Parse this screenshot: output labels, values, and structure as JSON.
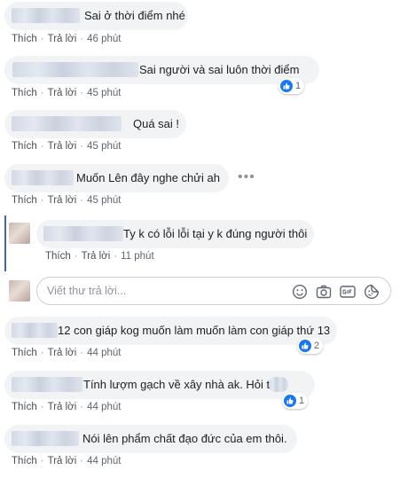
{
  "actions": {
    "like": "Thích",
    "reply": "Trả lời",
    "separator": "·"
  },
  "comments": [
    {
      "text": "Sai ở thời điểm nhé",
      "time": "46 phút"
    },
    {
      "text": "Sai người và sai luôn thời điểm",
      "time": "45 phút",
      "reactions": "1"
    },
    {
      "text": "Quá sai !",
      "time": "45 phút"
    },
    {
      "text": "Muốn Lên đây nghe chửi ah",
      "time": "45 phút"
    },
    {
      "text": "Ty k có lỗi lỗi tại y k đúng người thôi",
      "time": "11 phút"
    },
    {
      "text": "12 con giáp kog muốn làm muốn làm con giáp thứ 13",
      "time": "44 phút",
      "reactions": "2"
    },
    {
      "text": "Tính lượm gạch về xây nhà ak. Hỏi       thế",
      "time": "44 phút",
      "reactions": "1"
    },
    {
      "text": "Nói lên phẩm chất đạo đức của em thôi.",
      "time": "44 phút"
    }
  ],
  "more_options": "•••",
  "reply_box": {
    "placeholder": "Viết thư trả lời...",
    "icons": [
      "emoji-icon",
      "camera-icon",
      "gif-icon",
      "sticker-icon"
    ]
  },
  "colors": {
    "bubble": "#f2f3f5",
    "link": "#4b4f56",
    "like_blue": "#1877f2",
    "thread_line": "#4267b2"
  }
}
